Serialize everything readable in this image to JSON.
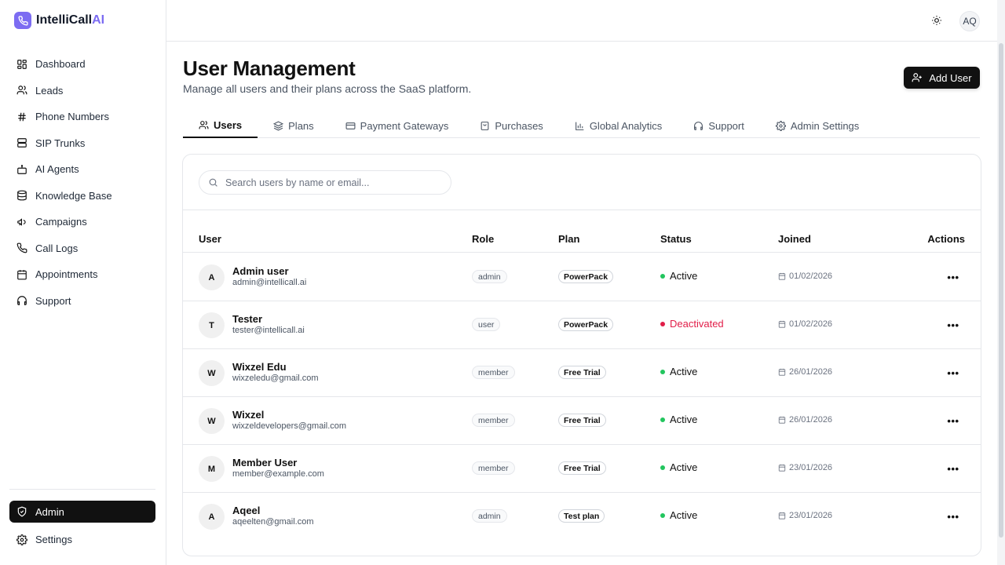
{
  "brand": {
    "name": "IntelliCall",
    "suffix": "AI"
  },
  "sidebar": {
    "items": [
      {
        "label": "Dashboard",
        "icon": "dashboard-icon"
      },
      {
        "label": "Leads",
        "icon": "users-icon"
      },
      {
        "label": "Phone Numbers",
        "icon": "hash-icon"
      },
      {
        "label": "SIP Trunks",
        "icon": "server-icon"
      },
      {
        "label": "AI Agents",
        "icon": "bot-icon"
      },
      {
        "label": "Knowledge Base",
        "icon": "database-icon"
      },
      {
        "label": "Campaigns",
        "icon": "megaphone-icon"
      },
      {
        "label": "Call Logs",
        "icon": "phone-icon"
      },
      {
        "label": "Appointments",
        "icon": "calendar-icon"
      },
      {
        "label": "Support",
        "icon": "headphones-icon"
      }
    ],
    "bottom": [
      {
        "label": "Admin",
        "icon": "shield-icon",
        "active": true
      },
      {
        "label": "Settings",
        "icon": "gear-icon"
      }
    ]
  },
  "topbar": {
    "avatar_initials": "AQ",
    "theme_icon": "sun-icon"
  },
  "header": {
    "title": "User Management",
    "subtitle": "Manage all users and their plans across the SaaS platform.",
    "add_user_label": "Add User"
  },
  "tabs": [
    {
      "label": "Users",
      "icon": "users-icon",
      "active": true
    },
    {
      "label": "Plans",
      "icon": "layers-icon"
    },
    {
      "label": "Payment Gateways",
      "icon": "credit-card-icon"
    },
    {
      "label": "Purchases",
      "icon": "shopping-bag-icon"
    },
    {
      "label": "Global Analytics",
      "icon": "bar-chart-icon"
    },
    {
      "label": "Support",
      "icon": "headphones-icon"
    },
    {
      "label": "Admin Settings",
      "icon": "gear-icon"
    }
  ],
  "search": {
    "placeholder": "Search users by name or email..."
  },
  "table": {
    "columns": [
      "User",
      "Role",
      "Plan",
      "Status",
      "Joined",
      "Actions"
    ],
    "rows": [
      {
        "initial": "A",
        "name": "Admin user",
        "email": "admin@intellicall.ai",
        "role": "admin",
        "plan": "PowerPack",
        "status": "Active",
        "joined": "01/02/2026"
      },
      {
        "initial": "T",
        "name": "Tester",
        "email": "tester@intellicall.ai",
        "role": "user",
        "plan": "PowerPack",
        "status": "Deactivated",
        "joined": "01/02/2026"
      },
      {
        "initial": "W",
        "name": "Wixzel Edu",
        "email": "wixzeledu@gmail.com",
        "role": "member",
        "plan": "Free Trial",
        "status": "Active",
        "joined": "26/01/2026"
      },
      {
        "initial": "W",
        "name": "Wixzel",
        "email": "wixzeldevelopers@gmail.com",
        "role": "member",
        "plan": "Free Trial",
        "status": "Active",
        "joined": "26/01/2026"
      },
      {
        "initial": "M",
        "name": "Member User",
        "email": "member@example.com",
        "role": "member",
        "plan": "Free Trial",
        "status": "Active",
        "joined": "23/01/2026"
      },
      {
        "initial": "A",
        "name": "Aqeel",
        "email": "aqeelten@gmail.com",
        "role": "admin",
        "plan": "Test plan",
        "status": "Active",
        "joined": "23/01/2026"
      }
    ],
    "actions_glyph": "•••"
  },
  "colors": {
    "accent": "#7c6cf2",
    "active": "#22c55e",
    "deactivated": "#e11d48"
  }
}
